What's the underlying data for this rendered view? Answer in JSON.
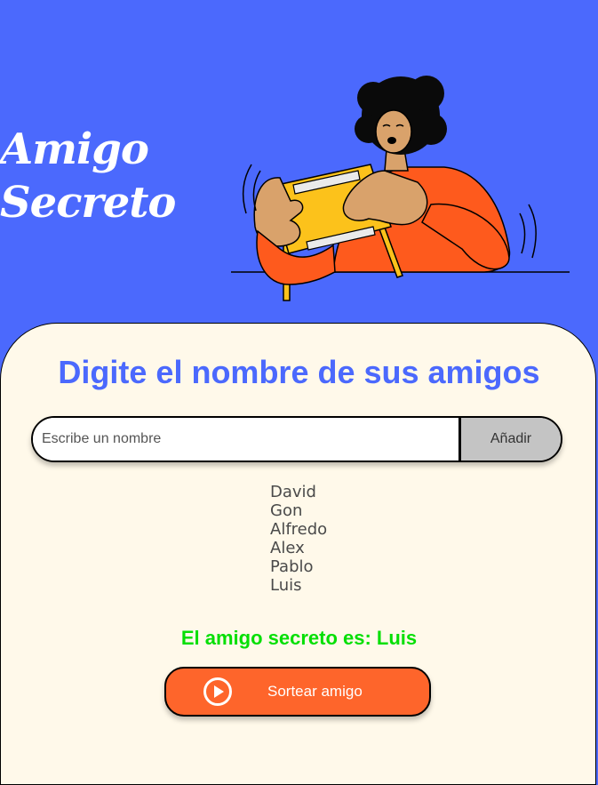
{
  "header": {
    "title_line1": "Amigo",
    "title_line2": "Secreto"
  },
  "main": {
    "subtitle": "Digite el nombre de sus amigos",
    "input": {
      "placeholder": "Escribe un nombre",
      "value": ""
    },
    "add_button_label": "Añadir",
    "friends": [
      "David",
      "Gon",
      "Alfredo",
      "Alex",
      "Pablo",
      "Luis"
    ],
    "result_text": "El amigo secreto es: Luis",
    "draw_button_label": "Sortear amigo",
    "draw_button_icon": "play-circle-icon"
  },
  "colors": {
    "background": "#4b69fd",
    "card": "#fff9ea",
    "accent": "#4b69fd",
    "button": "#fe652b",
    "result": "#05df05",
    "add_button": "#c4c4c4"
  }
}
